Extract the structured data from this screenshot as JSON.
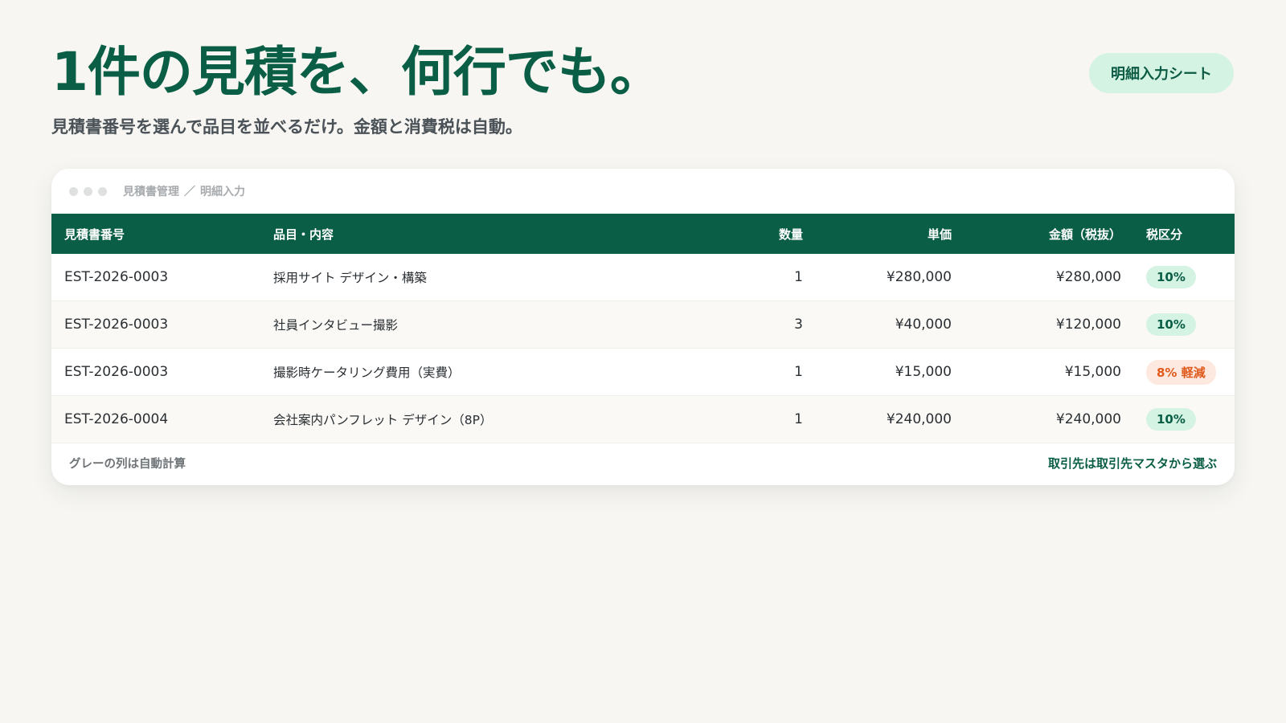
{
  "hero": {
    "title": "1件の見積を、何行でも。",
    "subtitle": "見積書番号を選んで品目を並べるだけ。金額と消費税は自動。",
    "badge": "明細入力シート"
  },
  "window": {
    "breadcrumb": [
      "見積書管理",
      "／",
      "明細入力"
    ]
  },
  "table": {
    "columns": {
      "no": "見積書番号",
      "item": "品目・内容",
      "qty": "数量",
      "unit": "単価",
      "amount": "金額（税抜）",
      "tax": "税区分"
    },
    "rows": [
      {
        "no": "EST-2026-0003",
        "item": "採用サイト デザイン・構築",
        "qty": "1",
        "unit": "¥280,000",
        "amount": "¥280,000",
        "tax": "10%",
        "tax_type": "std"
      },
      {
        "no": "EST-2026-0003",
        "item": "社員インタビュー撮影",
        "qty": "3",
        "unit": "¥40,000",
        "amount": "¥120,000",
        "tax": "10%",
        "tax_type": "std"
      },
      {
        "no": "EST-2026-0003",
        "item": "撮影時ケータリング費用（実費）",
        "qty": "1",
        "unit": "¥15,000",
        "amount": "¥15,000",
        "tax": "8% 軽減",
        "tax_type": "reduced"
      },
      {
        "no": "EST-2026-0004",
        "item": "会社案内パンフレット デザイン（8P）",
        "qty": "1",
        "unit": "¥240,000",
        "amount": "¥240,000",
        "tax": "10%",
        "tax_type": "std"
      }
    ]
  },
  "footer": {
    "note": "グレーの列は自動計算",
    "link": "取引先は取引先マスタから選ぶ"
  },
  "colors": {
    "brand": "#0a5e45",
    "badge_bg": "#d4f3e3",
    "reduced_bg": "#fde9df",
    "reduced_fg": "#e05a1c"
  }
}
